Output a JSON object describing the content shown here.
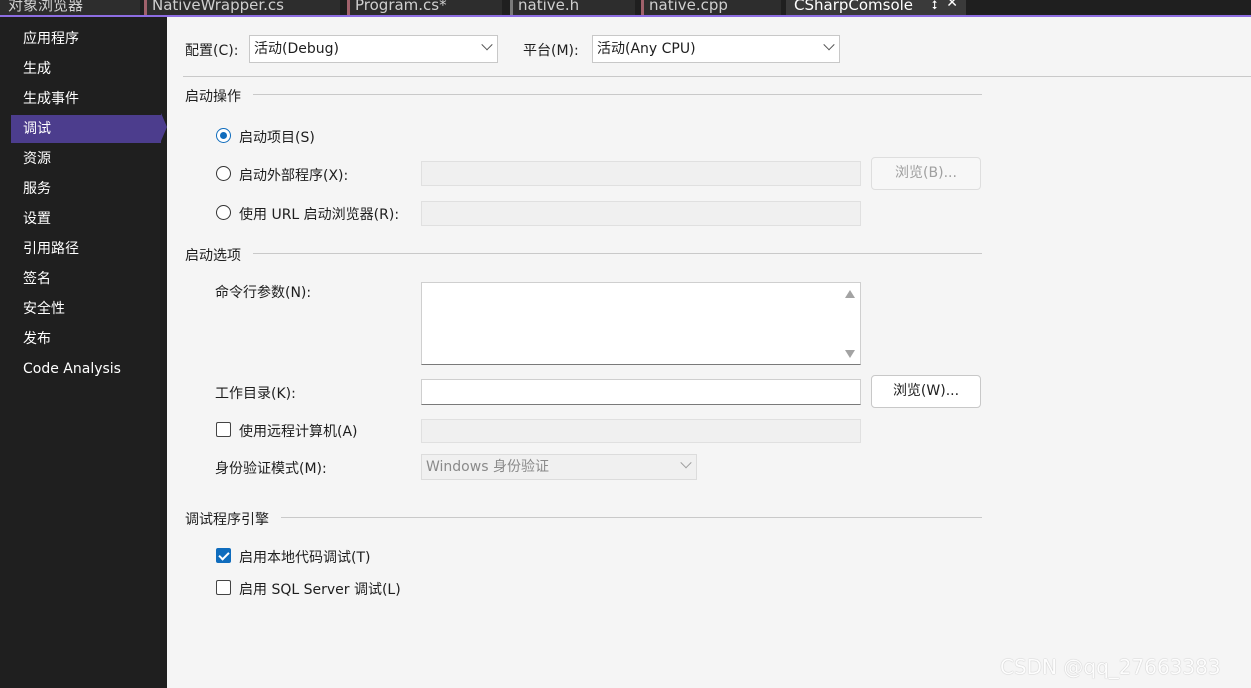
{
  "tabs": [
    {
      "label": "对象浏览器",
      "bar_color": "#8a6e59"
    },
    {
      "label": "NativeWrapper.cs",
      "bar_color": "#a0616b"
    },
    {
      "label": "Program.cs*",
      "bar_color": "#a0616b"
    },
    {
      "label": "native.h",
      "bar_color": "#7a7a7a"
    },
    {
      "label": "native.cpp",
      "bar_color": "#a0616b"
    },
    {
      "label": "CSharpComsole",
      "active": true
    }
  ],
  "tab_icons": {
    "pin": "pin-icon",
    "close": "close-icon"
  },
  "sidebar": {
    "items": [
      {
        "label": "应用程序"
      },
      {
        "label": "生成"
      },
      {
        "label": "生成事件"
      },
      {
        "label": "调试",
        "selected": true
      },
      {
        "label": "资源"
      },
      {
        "label": "服务"
      },
      {
        "label": "设置"
      },
      {
        "label": "引用路径"
      },
      {
        "label": "签名"
      },
      {
        "label": "安全性"
      },
      {
        "label": "发布"
      },
      {
        "label": "Code Analysis"
      }
    ]
  },
  "config": {
    "config_label": "配置(C):",
    "config_value": "活动(Debug)",
    "platform_label": "平台(M):",
    "platform_value": "活动(Any CPU)"
  },
  "start_action": {
    "title": "启动操作",
    "start_project": "启动项目(S)",
    "start_external": "启动外部程序(X):",
    "browse_b": "浏览(B)...",
    "start_url": "使用 URL 启动浏览器(R):",
    "selected": "start_project"
  },
  "start_options": {
    "title": "启动选项",
    "cmd_args_label": "命令行参数(N):",
    "cmd_args_value": "",
    "workdir_label": "工作目录(K):",
    "workdir_value": "",
    "browse_w": "浏览(W)...",
    "remote_label": "使用远程计算机(A)",
    "remote_checked": false,
    "auth_label": "身份验证模式(M):",
    "auth_value": "Windows 身份验证"
  },
  "debugger_engines": {
    "title": "调试程序引擎",
    "native_label": "启用本地代码调试(T)",
    "native_checked": true,
    "sql_label": "启用 SQL Server 调试(L)",
    "sql_checked": false
  },
  "colors": {
    "accent": "#0f6cbd",
    "sidebar_bg": "#1f1f1f",
    "sidebar_selected": "#4c3d8d",
    "tab_underline": "#8d6de2"
  },
  "watermark": "CSDN @qq_27663383"
}
